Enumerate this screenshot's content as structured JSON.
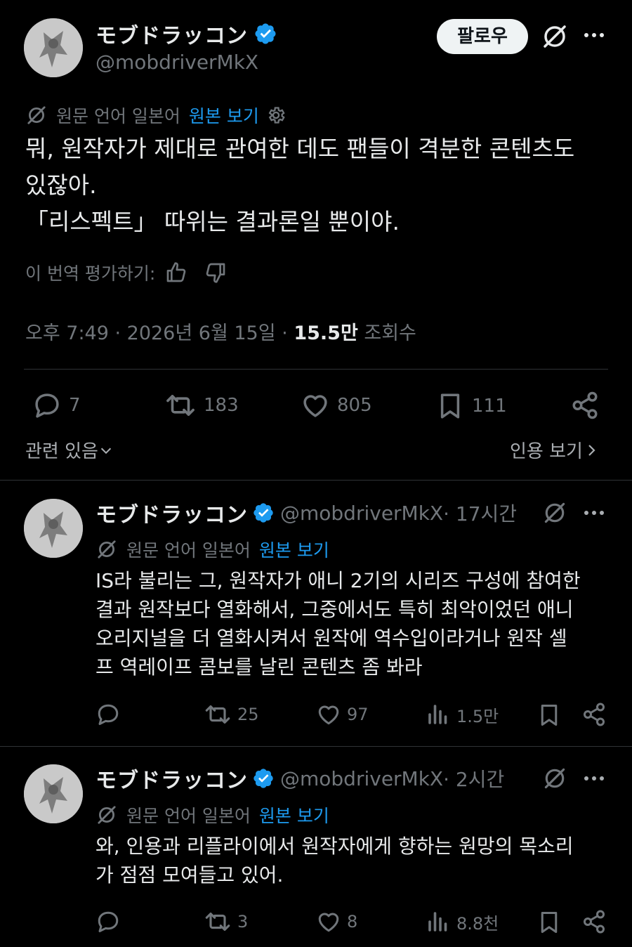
{
  "colors": {
    "background": "#000000",
    "text": "#e7e9ea",
    "muted": "#71767b",
    "link": "#1d9bf0",
    "verified": "#1d9bf0",
    "divider": "#2f3336"
  },
  "main_post": {
    "author_name": "モブドラッコン",
    "author_handle": "@mobdriverMkX",
    "follow_label": "팔로우",
    "translation_source": "원문 언어 일본어",
    "show_original": "원본 보기",
    "text_lines": [
      "뭐, 원작자가 제대로 관여한 데도 팬들이 격분한 콘텐츠도",
      "있잖아.",
      "「리스펙트」 따위는 결과론일 뿐이야."
    ],
    "rate_translation": "이 번역 평가하기:",
    "time": "오후 7:49 · 2026년 6월 15일 · ",
    "views_count": "15.5만",
    "views_label": " 조회수",
    "replies": "7",
    "reposts": "183",
    "likes": "805",
    "bookmarks": "111",
    "related_label": "관련 있음",
    "view_quotes_label": "인용 보기"
  },
  "replies": [
    {
      "author_name": "モブドラッコン",
      "author_handle": "@mobdriverMkX",
      "time": " · 17시간",
      "translation_source": "원문 언어 일본어",
      "show_original": "원본 보기",
      "text_lines": [
        "IS라 불리는 그, 원작자가 애니 2기의 시리즈 구성에 참여한",
        "결과 원작보다 열화해서, 그중에서도 특히 최악이었던 애니",
        "오리지널을 더 열화시켜서 원작에 역수입이라거나 원작 셀",
        "프 역레이프 콤보를 날린 콘텐츠 좀 봐라"
      ],
      "reposts": "25",
      "likes": "97",
      "views": "1.5만"
    },
    {
      "author_name": "モブドラッコン",
      "author_handle": "@mobdriverMkX",
      "time": " · 2시간",
      "translation_source": "원문 언어 일본어",
      "show_original": "원본 보기",
      "text_lines": [
        "와, 인용과 리플라이에서 원작자에게 향하는 원망의 목소리",
        "가 점점 모여들고 있어."
      ],
      "reposts": "3",
      "likes": "8",
      "views": "8.8천"
    }
  ]
}
